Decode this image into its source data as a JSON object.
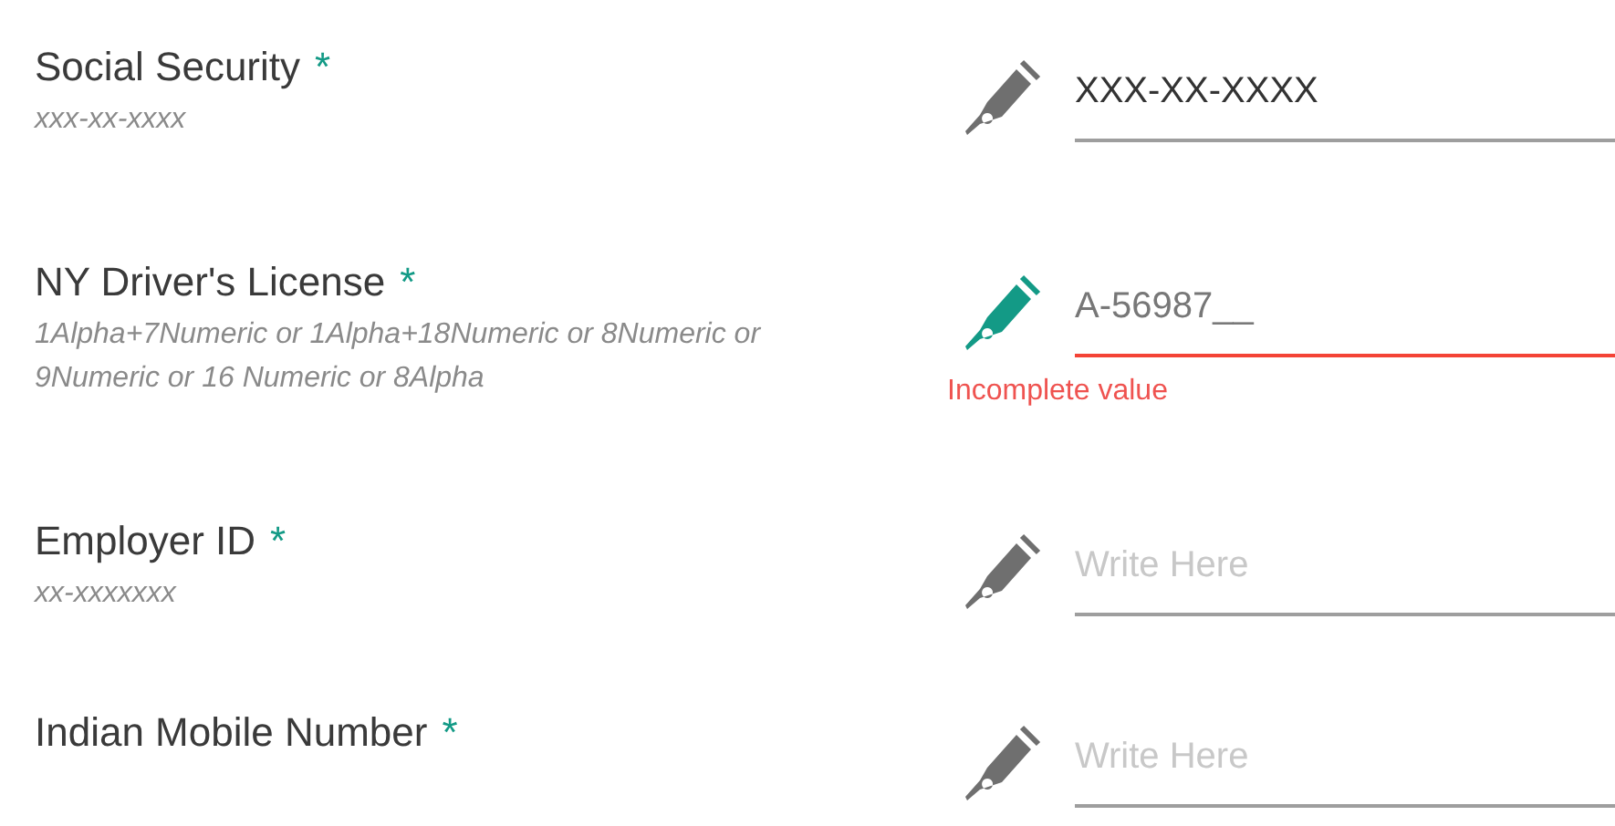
{
  "fields": [
    {
      "label": "Social Security",
      "required_mark": "*",
      "hint": "xxx-xx-xxxx",
      "value": "XXX-XX-XXXX",
      "focused": false
    },
    {
      "label": "NY Driver's License",
      "required_mark": "*",
      "hint": "1Alpha+7Numeric or 1Alpha+18Numeric or 8Numeric or 9Numeric or 16 Numeric or 8Alpha",
      "value": "A-56987__",
      "focused": true,
      "error": "Incomplete value"
    },
    {
      "label": "Employer ID",
      "required_mark": "*",
      "hint": "xx-xxxxxxx",
      "placeholder": "Write Here",
      "focused": false
    },
    {
      "label": "Indian Mobile Number",
      "required_mark": "*",
      "placeholder": "Write Here",
      "focused": false
    }
  ]
}
